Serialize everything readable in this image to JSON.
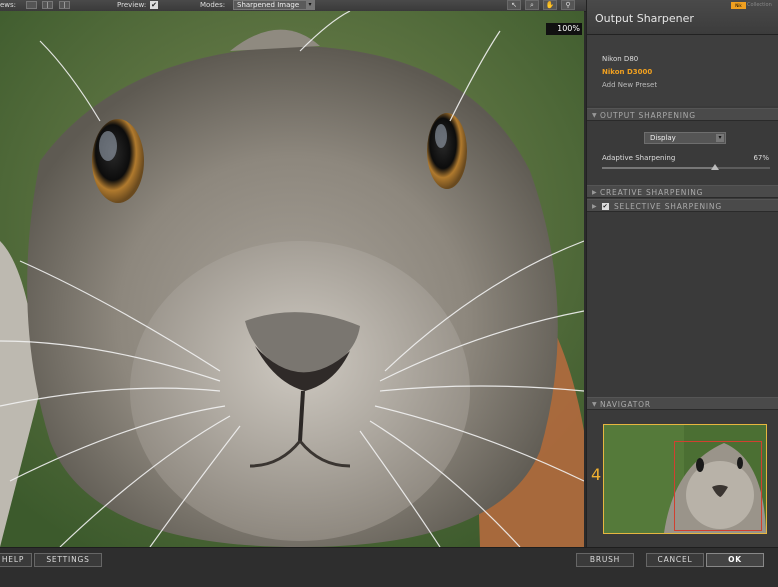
{
  "toolbar": {
    "views_label": "ews:",
    "preview_label": "Preview:",
    "preview_checked": "✔",
    "modes_label": "Modes:",
    "mode_value": "Sharpened Image",
    "tool_icons": [
      "pointer-icon",
      "zoom-icon",
      "hand-icon",
      "dropper-icon"
    ]
  },
  "image": {
    "zoom": "100%"
  },
  "panel": {
    "title": "Output Sharpener",
    "logo": {
      "badge": "Nik",
      "text": "Collection"
    },
    "presets": [
      {
        "label": "Nikon D80",
        "color": "#dddddd"
      },
      {
        "label": "Nikon D3000",
        "color": "#f0a020"
      },
      {
        "label": "Add New Preset",
        "color": "#bbbbbb"
      }
    ],
    "output_sharpening": {
      "header": "OUTPUT SHARPENING",
      "dropdown_value": "Display",
      "adaptive_label": "Adaptive Sharpening",
      "adaptive_value": "67%",
      "adaptive_level": 0.67
    },
    "creative_header": "CREATIVE SHARPENING",
    "selective_header": "SELECTIVE SHARPENING",
    "selective_checked": "✔",
    "navigator_header": "NAVIGATOR",
    "navigator_number": "4"
  },
  "buttons": {
    "help": "HELP",
    "settings": "SETTINGS",
    "brush": "BRUSH",
    "cancel": "CANCEL",
    "ok": "OK"
  },
  "colors": {
    "accent": "#f0a020",
    "navigator_border": "#e6b640",
    "panel_bg": "#3a3a3a"
  }
}
